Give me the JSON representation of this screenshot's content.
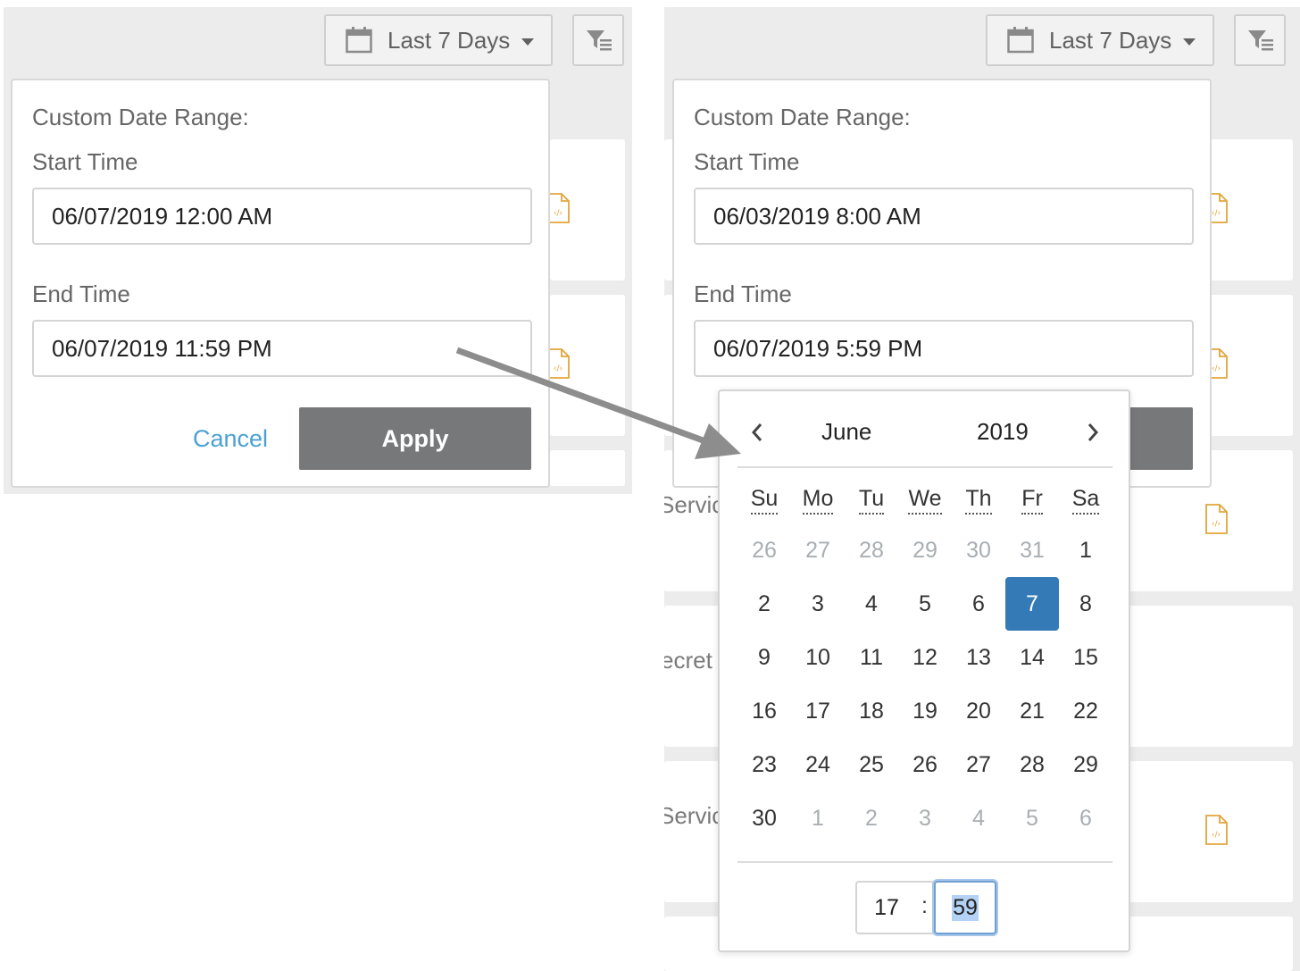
{
  "left": {
    "range_button": {
      "label": "Last 7 Days",
      "icon": "calendar-icon"
    },
    "filter_button": {
      "icon": "filter-list-icon"
    },
    "dropdown": {
      "title": "Custom Date Range:",
      "start_label": "Start Time",
      "start_value": "06/07/2019 12:00 AM",
      "end_label": "End Time",
      "end_value": "06/07/2019 11:59 PM",
      "cancel_label": "Cancel",
      "apply_label": "Apply"
    }
  },
  "right": {
    "range_button": {
      "label": "Last 7 Days",
      "icon": "calendar-icon"
    },
    "filter_button": {
      "icon": "filter-list-icon"
    },
    "dropdown": {
      "title": "Custom Date Range:",
      "start_label": "Start Time",
      "start_value": "06/03/2019 8:00 AM",
      "end_label": "End Time",
      "end_value": "06/07/2019 5:59 PM"
    },
    "background_rows": [
      "Servic",
      "ecret",
      "Servic"
    ],
    "calendar": {
      "month": "June",
      "year": "2019",
      "weekdays": [
        "Su",
        "Mo",
        "Tu",
        "We",
        "Th",
        "Fr",
        "Sa"
      ],
      "weeks": [
        [
          "26",
          "27",
          "28",
          "29",
          "30",
          "31",
          "1"
        ],
        [
          "2",
          "3",
          "4",
          "5",
          "6",
          "7",
          "8"
        ],
        [
          "9",
          "10",
          "11",
          "12",
          "13",
          "14",
          "15"
        ],
        [
          "16",
          "17",
          "18",
          "19",
          "20",
          "21",
          "22"
        ],
        [
          "23",
          "24",
          "25",
          "26",
          "27",
          "28",
          "29"
        ],
        [
          "30",
          "1",
          "2",
          "3",
          "4",
          "5",
          "6"
        ]
      ],
      "selected_day": "7",
      "hour": "17",
      "time_separator": ":",
      "minute": "59"
    }
  },
  "colors": {
    "accent": "#337ab7",
    "link": "#4aa1d6",
    "apply_button": "#77787a",
    "file_icon": "#e2a53b",
    "arrow": "#8d8d8d"
  }
}
